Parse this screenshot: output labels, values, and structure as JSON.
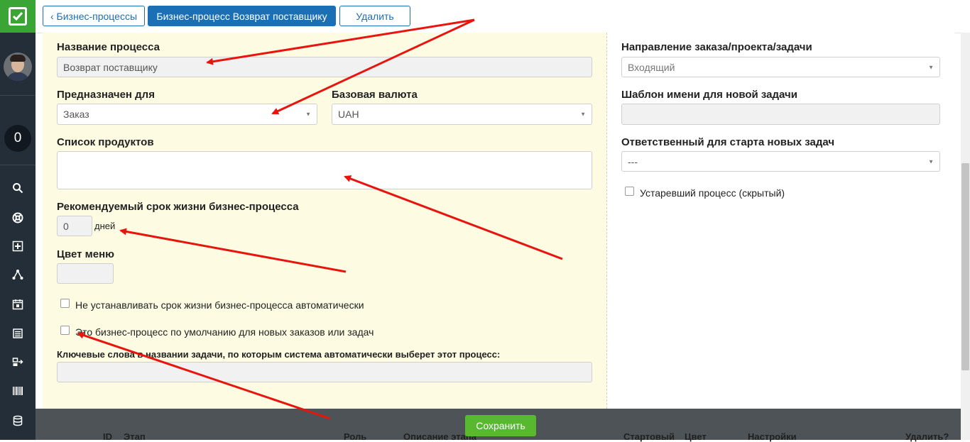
{
  "topbar": {
    "back_label": "‹ Бизнес-процессы",
    "title_label": "Бизнес-процесс Возврат поставщику",
    "delete_label": "Удалить"
  },
  "sidebar": {
    "counter": "0",
    "icons": [
      "search-icon",
      "support-icon",
      "add-icon",
      "share-icon",
      "calendar-icon",
      "list-icon",
      "transfer-icon",
      "barcode-icon",
      "database-icon"
    ]
  },
  "form": {
    "process_name": {
      "label": "Название процесса",
      "value": "Возврат поставщику"
    },
    "intended_for": {
      "label": "Предназначен для",
      "value": "Заказ"
    },
    "base_currency": {
      "label": "Базовая валюта",
      "value": "UAH"
    },
    "product_list": {
      "label": "Список продуктов",
      "value": ""
    },
    "lifetime": {
      "label": "Рекомендуемый срок жизни бизнес-процесса",
      "value": "0",
      "unit": "дней"
    },
    "menu_color": {
      "label": "Цвет меню",
      "value": ""
    },
    "no_auto_lifetime": {
      "label": "Не устанавливать срок жизни бизнес-процесса автоматически",
      "checked": false
    },
    "default_process": {
      "label": "Это бизнес-процесс по умолчанию для новых заказов или задач",
      "checked": false
    },
    "keywords": {
      "label": "Ключевые слова в названии задачи, по которым система автоматически выберет этот процесс:",
      "value": ""
    },
    "direction": {
      "label": "Направление заказа/проекта/задачи",
      "value": "Входящий"
    },
    "task_template": {
      "label": "Шаблон имени для новой задачи",
      "value": ""
    },
    "responsible": {
      "label": "Ответственный для старта новых задач",
      "value": "---"
    },
    "obsolete": {
      "label": "Устаревший процесс (скрытый)",
      "checked": false
    }
  },
  "save_label": "Сохранить",
  "table": {
    "headers": [
      "ID",
      "Этап",
      "Роль",
      "Описание этапа",
      "Стартовый",
      "Цвет",
      "Настройки",
      "Удалить?"
    ]
  },
  "colors": {
    "sidebar": "#232e38",
    "logo": "#3aa535",
    "primary": "#1b6fb5",
    "form_bg": "#fdfce3",
    "save": "#58b82e",
    "annotation_arrow": "#e8140e"
  }
}
